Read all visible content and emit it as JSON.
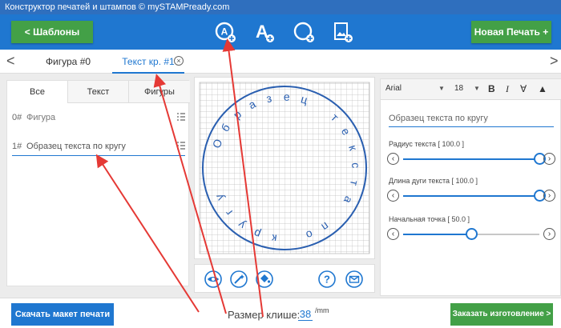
{
  "window": {
    "title": "Конструктор печатей и штампов © mySTAMPready.com"
  },
  "toolbar": {
    "templates_label": "<  Шаблоны",
    "new_print_label": "Новая Печать +",
    "tools": [
      "add-circle-text-icon",
      "add-text-icon",
      "add-circle-icon",
      "add-image-icon"
    ]
  },
  "tabs": {
    "left_arrow": "<",
    "right_arrow": ">",
    "items": [
      {
        "label": "Фигура #0"
      },
      {
        "label": "Текст кр. #1"
      }
    ],
    "close": "×"
  },
  "layers_panel": {
    "tabs": [
      "Все",
      "Текст",
      "Фигуры"
    ],
    "items": [
      {
        "num": "0#",
        "name": "Фигура"
      },
      {
        "num": "1#",
        "name": "Образец текста по кругу"
      }
    ]
  },
  "stamp": {
    "circle_text": "Образец текста по кругу",
    "border_color": "#2a5fb0",
    "text_color": "#2a5fb0"
  },
  "canvas_tools": [
    "eye-icon",
    "magic-wand-icon",
    "paint-bucket-icon",
    "help-icon",
    "mail-icon"
  ],
  "properties": {
    "font": "Arial",
    "font_size": "18",
    "bold": "B",
    "italic": "I",
    "text_value": "Образец текста по кругу",
    "sliders": [
      {
        "label": "Радиус текста [ 100.0 ]",
        "fraction": 1.0
      },
      {
        "label": "Длина дуги текста [ 100.0 ]",
        "fraction": 1.0
      },
      {
        "label": "Начальная точка [ 50.0 ]",
        "fraction": 0.5
      }
    ]
  },
  "footer": {
    "download_label": "Скачать макет печати",
    "size_label": "Размер клише:",
    "size_value": "38",
    "size_unit": "/mm",
    "order_label": "Заказать изготовление >"
  },
  "colors": {
    "primary": "#1f77d0",
    "green": "#43a047",
    "annotation": "#e53935"
  }
}
